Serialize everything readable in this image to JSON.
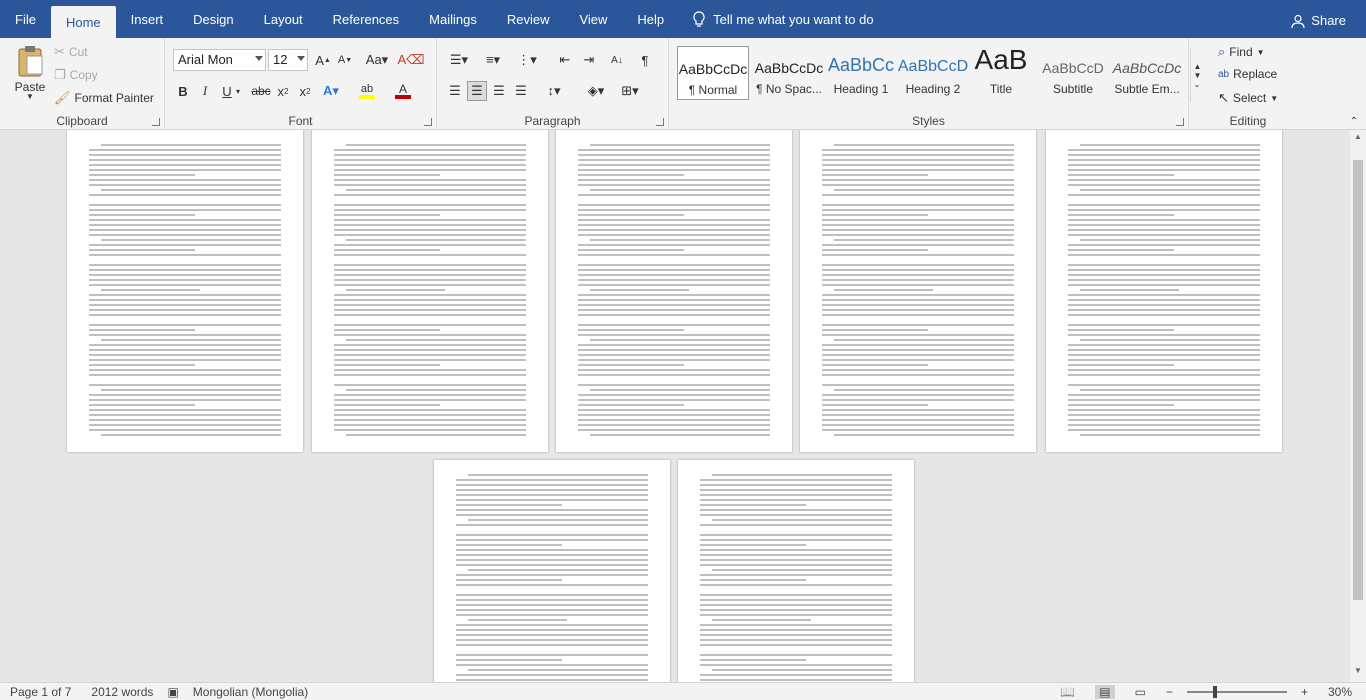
{
  "menubar": {
    "tabs": [
      "File",
      "Home",
      "Insert",
      "Design",
      "Layout",
      "References",
      "Mailings",
      "Review",
      "View",
      "Help"
    ],
    "active": "Home",
    "tell_me": "Tell me what you want to do",
    "share": "Share"
  },
  "clipboard": {
    "paste": "Paste",
    "cut": "Cut",
    "copy": "Copy",
    "format_painter": "Format Painter",
    "label": "Clipboard"
  },
  "font": {
    "name": "Arial Mon",
    "size": "12",
    "label": "Font"
  },
  "paragraph": {
    "label": "Paragraph"
  },
  "styles": {
    "items": [
      {
        "preview": "AaBbCcDc",
        "name": "¶ Normal"
      },
      {
        "preview": "AaBbCcDc",
        "name": "¶ No Spac..."
      },
      {
        "preview": "AaBbCc",
        "name": "Heading 1"
      },
      {
        "preview": "AaBbCcD",
        "name": "Heading 2"
      },
      {
        "preview": "AaB",
        "name": "Title"
      },
      {
        "preview": "AaBbCcD",
        "name": "Subtitle"
      },
      {
        "preview": "AaBbCcDc",
        "name": "Subtle Em..."
      }
    ],
    "label": "Styles"
  },
  "editing": {
    "find": "Find",
    "replace": "Replace",
    "select": "Select",
    "label": "Editing"
  },
  "status": {
    "page": "Page 1 of 7",
    "words": "2012 words",
    "language": "Mongolian (Mongolia)",
    "zoom": "30%"
  },
  "colors": {
    "brand": "#2b579a",
    "highlight": "#ffff00",
    "font_color": "#c00000"
  }
}
